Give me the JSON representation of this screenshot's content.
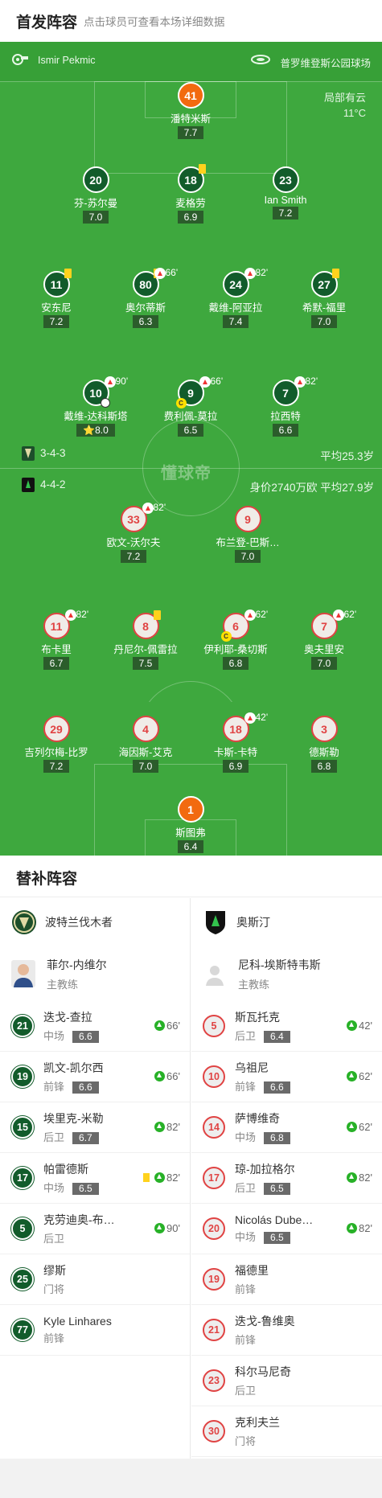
{
  "header": {
    "title": "首发阵容",
    "subtitle": "点击球员可查看本场详细数据"
  },
  "match": {
    "referee": "Ismir Pekmic",
    "venue": "普罗维登斯公园球场",
    "weather": "局部有云",
    "temperature": "11°C",
    "watermark": "懂球帝"
  },
  "home": {
    "formation": "3-4-3",
    "avg_age": "平均25.3岁",
    "players": [
      {
        "id": "h1",
        "num": "41",
        "name": "潘特米斯",
        "rating": "7.7",
        "gk": true
      },
      {
        "id": "h2",
        "num": "20",
        "name": "芬-苏尔曼",
        "rating": "7.0"
      },
      {
        "id": "h3",
        "num": "18",
        "name": "麦格劳",
        "rating": "6.9",
        "yellow": true
      },
      {
        "id": "h4",
        "num": "23",
        "name": "Ian Smith",
        "rating": "7.2"
      },
      {
        "id": "h5",
        "num": "11",
        "name": "安东尼",
        "rating": "7.2",
        "yellow": true
      },
      {
        "id": "h6",
        "num": "80",
        "name": "奥尔蒂斯",
        "rating": "6.3",
        "yellow": true,
        "sub": "66'"
      },
      {
        "id": "h7",
        "num": "24",
        "name": "戴维-阿亚拉",
        "rating": "7.4",
        "sub": "82'"
      },
      {
        "id": "h8",
        "num": "27",
        "name": "希默-福里",
        "rating": "7.0",
        "yellow": true
      },
      {
        "id": "h9",
        "num": "10",
        "name": "戴维-达科斯塔",
        "rating": "8.0",
        "sub": "90'",
        "goal": true,
        "star": "⭐"
      },
      {
        "id": "h10",
        "num": "9",
        "name": "费利佩-莫拉",
        "rating": "6.5",
        "sub": "66'",
        "captain": "C"
      },
      {
        "id": "h11",
        "num": "7",
        "name": "拉西特",
        "rating": "6.6",
        "sub": "82'"
      }
    ]
  },
  "away": {
    "formation": "4-4-2",
    "value_age": "身价2740万欧 平均27.9岁",
    "players": [
      {
        "id": "a1",
        "num": "33",
        "name": "欧文-沃尔夫",
        "rating": "7.2",
        "sub": "82'"
      },
      {
        "id": "a2",
        "num": "9",
        "name": "布兰登-巴斯…",
        "rating": "7.0"
      },
      {
        "id": "a3",
        "num": "11",
        "name": "布卡里",
        "rating": "6.7",
        "sub": "82'"
      },
      {
        "id": "a4",
        "num": "8",
        "name": "丹尼尔-佩雷拉",
        "rating": "7.5",
        "yellow": true
      },
      {
        "id": "a5",
        "num": "6",
        "name": "伊利耶-桑切斯",
        "rating": "6.8",
        "sub": "62'",
        "captain": "C"
      },
      {
        "id": "a6",
        "num": "7",
        "name": "奥夫里安",
        "rating": "7.0",
        "sub": "62'"
      },
      {
        "id": "a7",
        "num": "29",
        "name": "吉列尔梅-比罗",
        "rating": "7.2"
      },
      {
        "id": "a8",
        "num": "4",
        "name": "海因斯-艾克",
        "rating": "7.0"
      },
      {
        "id": "a9",
        "num": "18",
        "name": "卡斯-卡特",
        "rating": "6.9",
        "sub": "42'"
      },
      {
        "id": "a10",
        "num": "3",
        "name": "德斯勒",
        "rating": "6.8"
      },
      {
        "id": "a11",
        "num": "1",
        "name": "斯图弗",
        "rating": "6.4",
        "gk": true
      }
    ]
  },
  "bench": {
    "title": "替补阵容",
    "home_team": "波特兰伐木者",
    "away_team": "奥斯汀",
    "home_coach": {
      "name": "菲尔-内维尔",
      "title": "主教练"
    },
    "away_coach": {
      "name": "尼科-埃斯特韦斯",
      "title": "主教练"
    },
    "home_subs": [
      {
        "num": "21",
        "name": "迭戈-查拉",
        "pos": "中场",
        "rating": "6.6",
        "in": "66'"
      },
      {
        "num": "19",
        "name": "凯文-凯尔西",
        "pos": "前锋",
        "rating": "6.6",
        "in": "66'"
      },
      {
        "num": "15",
        "name": "埃里克-米勒",
        "pos": "后卫",
        "rating": "6.7",
        "in": "82'"
      },
      {
        "num": "17",
        "name": "帕雷德斯",
        "pos": "中场",
        "rating": "6.5",
        "in": "82'",
        "yellow": true
      },
      {
        "num": "5",
        "name": "克劳迪奥-布…",
        "pos": "后卫",
        "in": "90'"
      },
      {
        "num": "25",
        "name": "缪斯",
        "pos": "门将"
      },
      {
        "num": "77",
        "name": "Kyle Linhares",
        "pos": "前锋"
      }
    ],
    "away_subs": [
      {
        "num": "5",
        "name": "斯瓦托克",
        "pos": "后卫",
        "rating": "6.4",
        "in": "42'"
      },
      {
        "num": "10",
        "name": "乌祖尼",
        "pos": "前锋",
        "rating": "6.6",
        "in": "62'"
      },
      {
        "num": "14",
        "name": "萨博维奇",
        "pos": "中场",
        "rating": "6.8",
        "in": "62'"
      },
      {
        "num": "17",
        "name": "琼-加拉格尔",
        "pos": "后卫",
        "rating": "6.5",
        "in": "82'"
      },
      {
        "num": "20",
        "name": "Nicolás Dube…",
        "pos": "中场",
        "rating": "6.5",
        "in": "82'"
      },
      {
        "num": "19",
        "name": "福德里",
        "pos": "前锋"
      },
      {
        "num": "21",
        "name": "迭戈-鲁维奥",
        "pos": "前锋"
      },
      {
        "num": "23",
        "name": "科尔马尼奇",
        "pos": "后卫"
      },
      {
        "num": "30",
        "name": "克利夫兰",
        "pos": "门将"
      }
    ]
  }
}
